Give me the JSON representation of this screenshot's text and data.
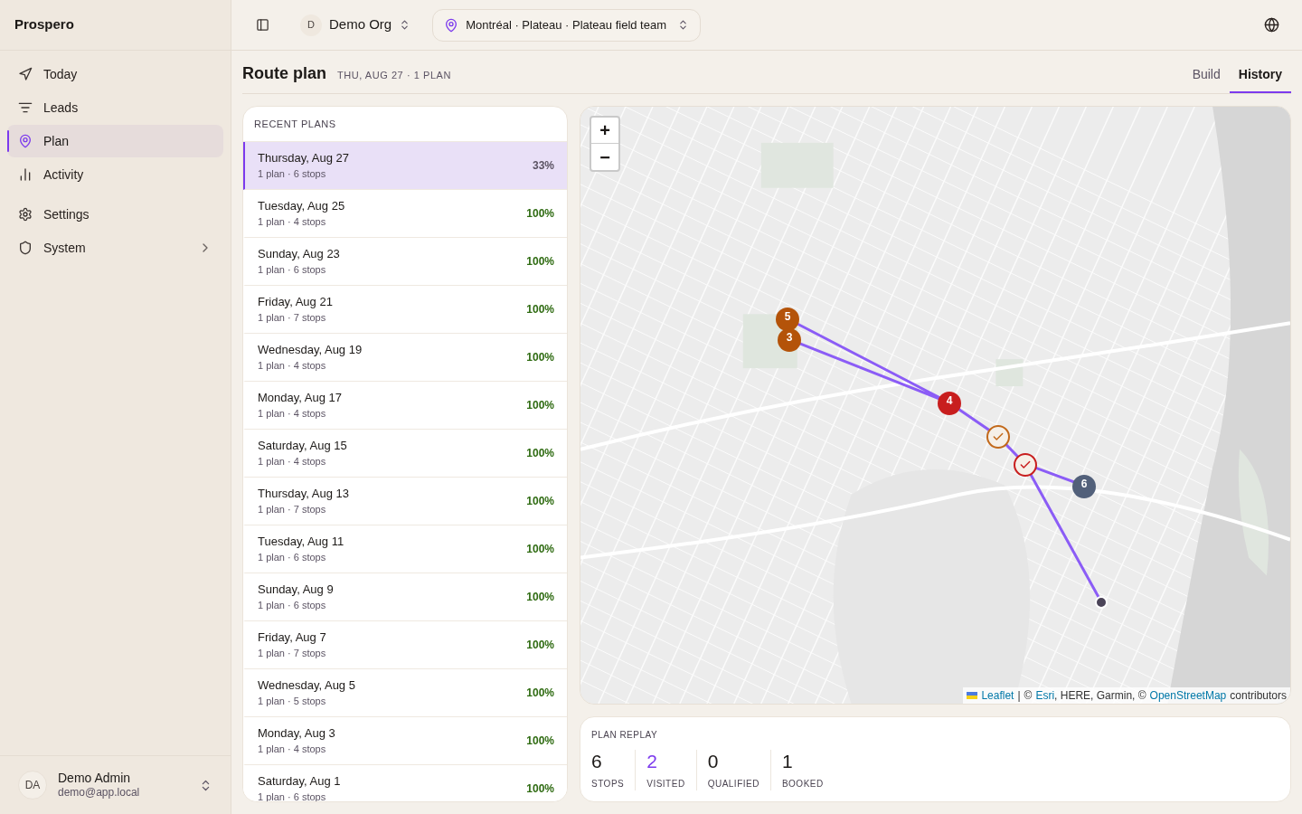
{
  "app": {
    "name": "Prospero"
  },
  "nav": {
    "main": [
      {
        "label": "Today",
        "selected": false
      },
      {
        "label": "Leads",
        "selected": false
      },
      {
        "label": "Plan",
        "selected": true
      },
      {
        "label": "Activity",
        "selected": false
      }
    ],
    "secondary": [
      {
        "label": "Settings",
        "selected": false,
        "expandable": false
      },
      {
        "label": "System",
        "selected": false,
        "expandable": true
      }
    ]
  },
  "user": {
    "initials": "DA",
    "name": "Demo Admin",
    "email": "demo@app.local"
  },
  "topbar": {
    "org_initial": "D",
    "org": "Demo Org",
    "location": "Montréal · Plateau · Plateau field team"
  },
  "page": {
    "title": "Route plan",
    "subtitle": "THU, AUG 27 · 1 PLAN"
  },
  "tabs": [
    {
      "label": "Build",
      "selected": false
    },
    {
      "label": "History",
      "selected": true
    }
  ],
  "recent_plans": {
    "heading": "RECENT PLANS",
    "rows": [
      {
        "date": "Thursday, Aug 27",
        "detail": "1 plan · 6 stops",
        "percent": "33%",
        "complete": false,
        "selected": true
      },
      {
        "date": "Tuesday, Aug 25",
        "detail": "1 plan · 4 stops",
        "percent": "100%",
        "complete": true,
        "selected": false
      },
      {
        "date": "Sunday, Aug 23",
        "detail": "1 plan · 6 stops",
        "percent": "100%",
        "complete": true,
        "selected": false
      },
      {
        "date": "Friday, Aug 21",
        "detail": "1 plan · 7 stops",
        "percent": "100%",
        "complete": true,
        "selected": false
      },
      {
        "date": "Wednesday, Aug 19",
        "detail": "1 plan · 4 stops",
        "percent": "100%",
        "complete": true,
        "selected": false
      },
      {
        "date": "Monday, Aug 17",
        "detail": "1 plan · 4 stops",
        "percent": "100%",
        "complete": true,
        "selected": false
      },
      {
        "date": "Saturday, Aug 15",
        "detail": "1 plan · 4 stops",
        "percent": "100%",
        "complete": true,
        "selected": false
      },
      {
        "date": "Thursday, Aug 13",
        "detail": "1 plan · 7 stops",
        "percent": "100%",
        "complete": true,
        "selected": false
      },
      {
        "date": "Tuesday, Aug 11",
        "detail": "1 plan · 6 stops",
        "percent": "100%",
        "complete": true,
        "selected": false
      },
      {
        "date": "Sunday, Aug 9",
        "detail": "1 plan · 6 stops",
        "percent": "100%",
        "complete": true,
        "selected": false
      },
      {
        "date": "Friday, Aug 7",
        "detail": "1 plan · 7 stops",
        "percent": "100%",
        "complete": true,
        "selected": false
      },
      {
        "date": "Wednesday, Aug 5",
        "detail": "1 plan · 5 stops",
        "percent": "100%",
        "complete": true,
        "selected": false
      },
      {
        "date": "Monday, Aug 3",
        "detail": "1 plan · 4 stops",
        "percent": "100%",
        "complete": true,
        "selected": false
      },
      {
        "date": "Saturday, Aug 1",
        "detail": "1 plan · 6 stops",
        "percent": "100%",
        "complete": true,
        "selected": false
      }
    ]
  },
  "map": {
    "zoom_in": "+",
    "zoom_out": "−",
    "markers": [
      {
        "kind": "number",
        "label": "5",
        "color": "#b45309"
      },
      {
        "kind": "number",
        "label": "3",
        "color": "#b45309"
      },
      {
        "kind": "number",
        "label": "4",
        "color": "#c81e1e"
      },
      {
        "kind": "check",
        "color": "#c2691b"
      },
      {
        "kind": "check",
        "color": "#c81e1e"
      },
      {
        "kind": "number",
        "label": "6",
        "color": "#52607a"
      },
      {
        "kind": "dot",
        "color": "#4b4458"
      }
    ],
    "attribution": {
      "leaflet": "Leaflet",
      "separator": "|",
      "copy1": "©",
      "esri": "Esri",
      "middle": ", HERE, Garmin, ©",
      "osm": "OpenStreetMap",
      "end": "contributors"
    }
  },
  "replay": {
    "heading": "PLAN REPLAY",
    "stats": [
      {
        "value": "6",
        "label": "STOPS",
        "accent": false
      },
      {
        "value": "2",
        "label": "VISITED",
        "accent": true
      },
      {
        "value": "0",
        "label": "QUALIFIED",
        "accent": false
      },
      {
        "value": "1",
        "label": "BOOKED",
        "accent": false
      }
    ]
  }
}
